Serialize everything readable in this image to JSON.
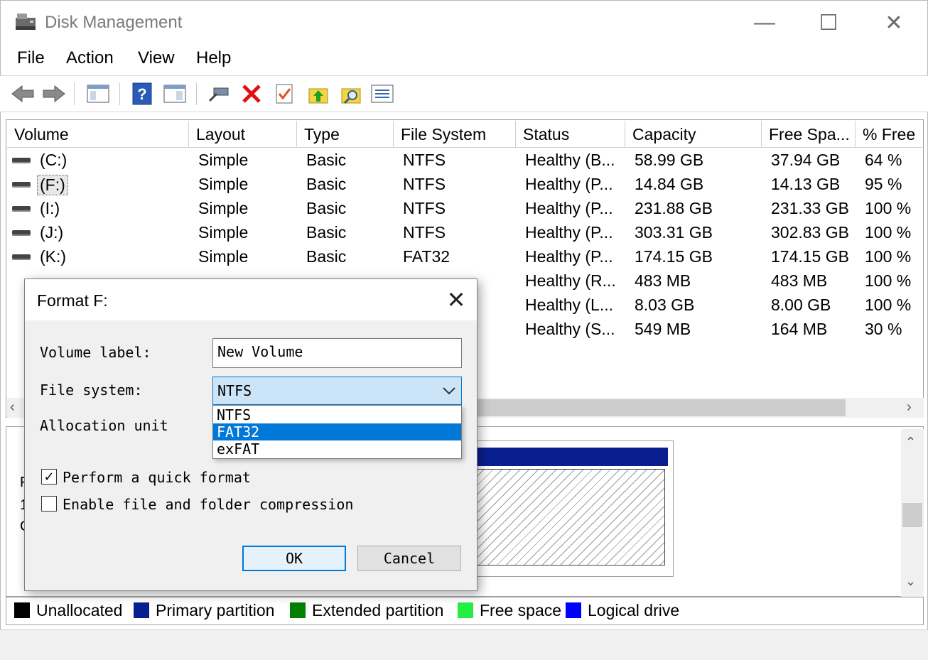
{
  "window": {
    "title": "Disk Management",
    "minimize": "—",
    "maximize": "☐",
    "close": "✕"
  },
  "menu": [
    "File",
    "Action",
    "View",
    "Help"
  ],
  "table": {
    "headers": [
      "Volume",
      "Layout",
      "Type",
      "File System",
      "Status",
      "Capacity",
      "Free Spa...",
      "% Free"
    ],
    "rows": [
      [
        "(C:)",
        "Simple",
        "Basic",
        "NTFS",
        "Healthy (B...",
        "58.99 GB",
        "37.94 GB",
        "64 %"
      ],
      [
        "(F:)",
        "Simple",
        "Basic",
        "NTFS",
        "Healthy (P...",
        "14.84 GB",
        "14.13 GB",
        "95 %"
      ],
      [
        "(I:)",
        "Simple",
        "Basic",
        "NTFS",
        "Healthy (P...",
        "231.88 GB",
        "231.33 GB",
        "100 %"
      ],
      [
        "(J:)",
        "Simple",
        "Basic",
        "NTFS",
        "Healthy (P...",
        "303.31 GB",
        "302.83 GB",
        "100 %"
      ],
      [
        "(K:)",
        "Simple",
        "Basic",
        "FAT32",
        "Healthy (P...",
        "174.15 GB",
        "174.15 GB",
        "100 %"
      ],
      [
        "",
        "",
        "",
        "",
        "Healthy (R...",
        "483 MB",
        "483 MB",
        "100 %"
      ],
      [
        "",
        "",
        "",
        "",
        "Healthy (L...",
        "8.03 GB",
        "8.00 GB",
        "100 %"
      ],
      [
        "",
        "",
        "",
        "",
        "Healthy (S...",
        "549 MB",
        "164 MB",
        "30 %"
      ]
    ]
  },
  "legend": [
    {
      "label": "Unallocated",
      "color": "#000000"
    },
    {
      "label": "Primary partition",
      "color": "#0a1f8f"
    },
    {
      "label": "Extended partition",
      "color": "#008000"
    },
    {
      "label": "Free space",
      "color": "#22ee44"
    },
    {
      "label": "Logical drive",
      "color": "#0000ff"
    }
  ],
  "dialog": {
    "title": "Format F:",
    "volume_label_caption": "Volume label:",
    "volume_label_value": "New Volume",
    "file_system_caption": "File system:",
    "file_system_value": "NTFS",
    "file_system_options": [
      "NTFS",
      "FAT32",
      "exFAT"
    ],
    "highlighted_option": "FAT32",
    "allocation_caption": "Allocation unit",
    "quick_format_label": "Perform a quick format",
    "quick_format_checked": true,
    "compression_label": "Enable file and folder compression",
    "compression_checked": false,
    "ok_label": "OK",
    "cancel_label": "Cancel"
  },
  "colors": {
    "selection": "#0078d7",
    "select_bg": "#cce4f7"
  }
}
